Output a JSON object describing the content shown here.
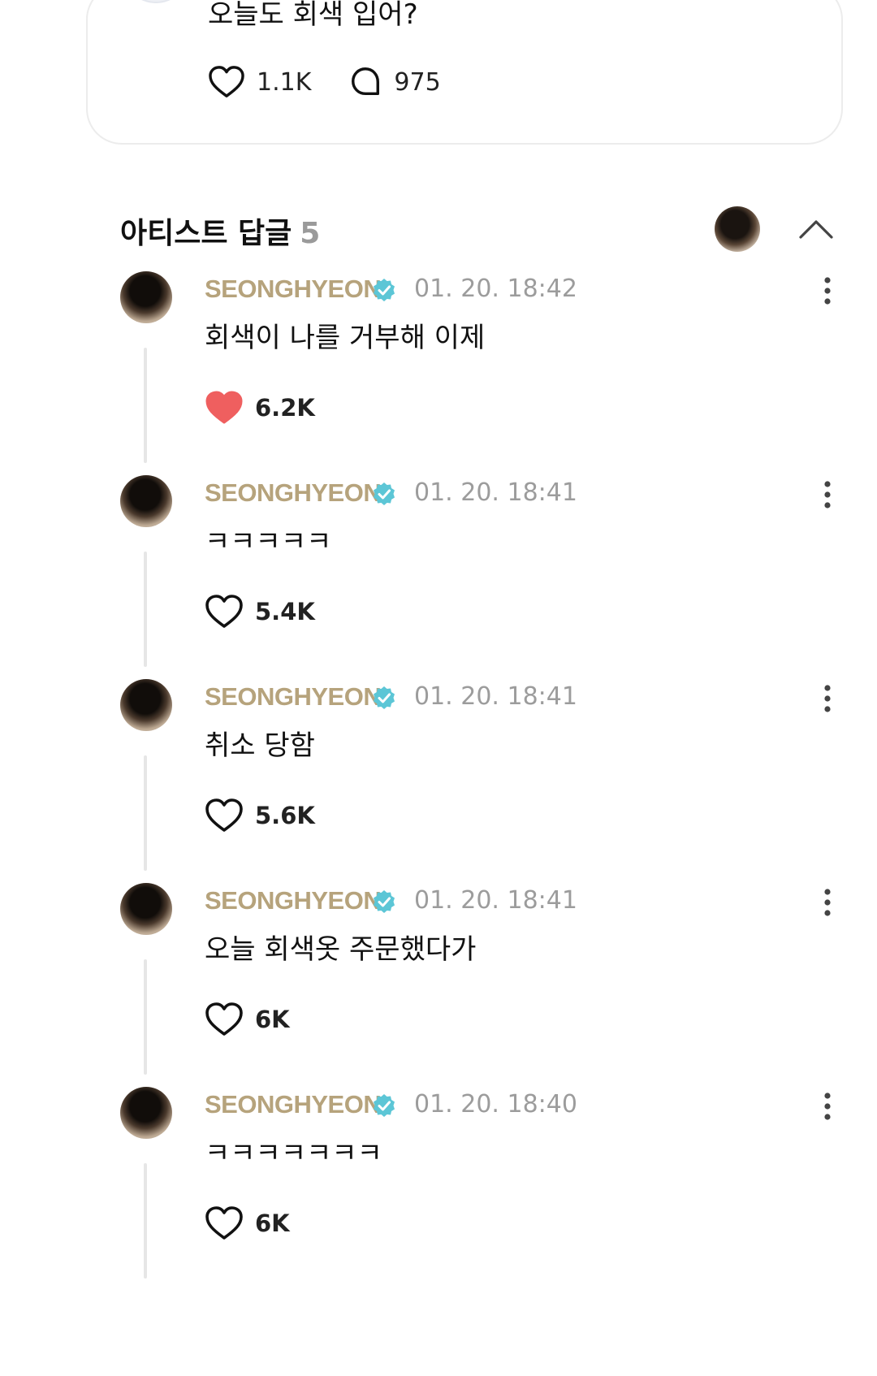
{
  "post": {
    "text": "오늘도 회색 입어?",
    "likes": "1.1K",
    "comments": "975"
  },
  "artist_replies": {
    "title": "아티스트 답글",
    "count": "5",
    "replies": [
      {
        "name": "SEONGHYEON",
        "time": "01. 20. 18:42",
        "text": "회색이 나를 거부해 이제",
        "likes": "6.2K",
        "liked": true
      },
      {
        "name": "SEONGHYEON",
        "time": "01. 20. 18:41",
        "text": "ㅋㅋㅋㅋㅋ",
        "likes": "5.4K",
        "liked": false
      },
      {
        "name": "SEONGHYEON",
        "time": "01. 20. 18:41",
        "text": "취소 당함",
        "likes": "5.6K",
        "liked": false
      },
      {
        "name": "SEONGHYEON",
        "time": "01. 20. 18:41",
        "text": "오늘 회색옷 주문했다가",
        "likes": "6K",
        "liked": false
      },
      {
        "name": "SEONGHYEON",
        "time": "01. 20. 18:40",
        "text": "ㅋㅋㅋㅋㅋㅋㅋ",
        "likes": "6K",
        "liked": false
      }
    ]
  },
  "colors": {
    "artist_name": "#b6a37c",
    "verified_badge": "#5cc6d6",
    "liked_heart": "#ef5f5f",
    "timestamp": "#9c9c9c",
    "count": "#9a9a9a"
  },
  "icons": {
    "like": "heart-icon",
    "comment": "comment-bubble-icon",
    "verified": "verified-badge-icon",
    "more": "more-vertical-icon",
    "collapse": "chevron-up-icon"
  }
}
